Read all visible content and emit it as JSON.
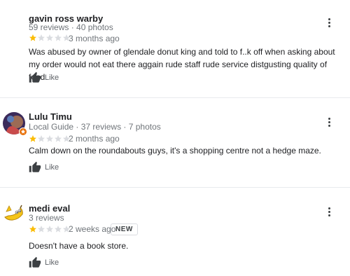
{
  "colors": {
    "star_filled": "#fbbc04",
    "star_empty": "#dadce0",
    "text": "#202124",
    "meta": "#70757a"
  },
  "reviews": [
    {
      "name": "gavin ross warby",
      "meta": "59 reviews · 40 photos",
      "rating": 1,
      "max_rating": 5,
      "date": "3 months ago",
      "text": "Was abused by owner of glendale donut king and told to f..k off when asking about my order would not eat there aggain rude staff rude service distgusting quality of food",
      "like_label": "Like",
      "avatar_icon": "none"
    },
    {
      "name": "Lulu Timu",
      "local_guide": "Local Guide",
      "meta": " · 37 reviews · 7 photos",
      "rating": 1,
      "max_rating": 5,
      "date": "2 months ago",
      "text": "Calm down on the roundabouts guys, it's a shopping centre not a hedge maze.",
      "like_label": "Like",
      "avatar_icon": "profile-photo"
    },
    {
      "name": "medi eval",
      "meta": "3 reviews",
      "rating": 1,
      "max_rating": 5,
      "date": "2 weeks ago",
      "badge": "NEW",
      "text": "Doesn't have a book store.",
      "like_label": "Like",
      "avatar_icon": "banana-avatar"
    }
  ]
}
